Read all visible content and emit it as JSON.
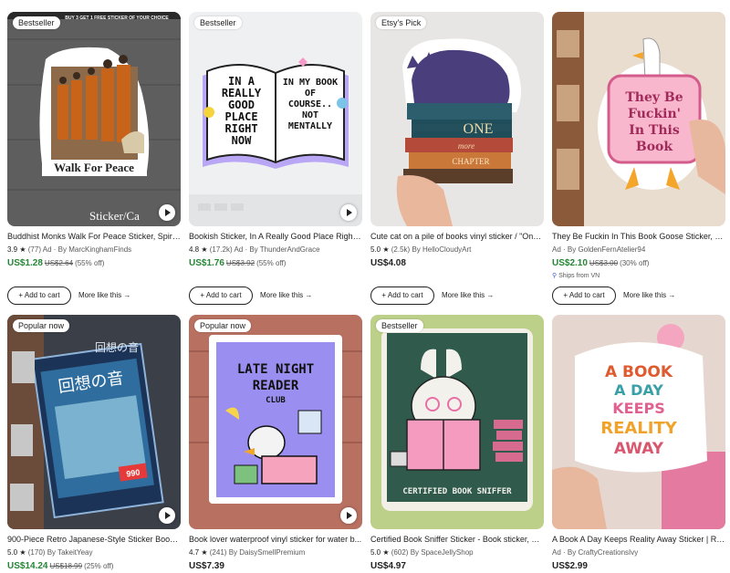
{
  "listings": [
    {
      "badge": "Bestseller",
      "title": "Buddhist Monks Walk For Peace Sticker, Spirit...",
      "rating": "3.9",
      "reviews": "(77)",
      "ad": "Ad · By MarcKinghamFinds",
      "price": "US$1.28",
      "orig": "US$2.64",
      "discount": "(55% off)",
      "image_text": "Walk For Peace",
      "image_text2": "Sticker/Ca",
      "image_text3": "BUY 3 GET 1 FREE STICKER OF YOUR CHOICE",
      "add": "+ Add to cart",
      "more": "More like this →"
    },
    {
      "badge": "Bestseller",
      "title": "Bookish Sticker, In A Really Good Place Right ...",
      "rating": "4.8",
      "reviews": "(17.2k)",
      "ad": "Ad · By ThunderAndGrace",
      "price": "US$1.76",
      "orig": "US$3.92",
      "discount": "(55% off)",
      "image_text": "IN A REALLY GOOD PLACE RIGHT NOW",
      "image_text2": "IN MY BOOK OF COURSE.. NOT MENTALLY",
      "add": "+ Add to cart",
      "more": "More like this →"
    },
    {
      "badge": "Etsy's Pick",
      "title": "Cute cat on a pile of books vinyl sticker / \"One...",
      "rating": "5.0",
      "reviews": "(2.5k)",
      "ad": "By HelloCloudyArt",
      "price": "US$4.08",
      "image_text": "ONE",
      "image_text2": "more",
      "image_text3": "CHAPTER",
      "add": "+ Add to cart",
      "more": "More like this →"
    },
    {
      "title": "They Be Fuckin In This Book Goose Sticker, Fu...",
      "ad": "Ad · By GoldenFernAtelier94",
      "price": "US$2.10",
      "orig": "US$3.00",
      "discount": "(30% off)",
      "ships": "Ships from VN",
      "image_text": "They Be",
      "image_text2": "Fuckin'",
      "image_text3": "In This",
      "image_text4": "Book",
      "add": "+ Add to cart",
      "more": "More like this →"
    },
    {
      "badge": "Popular now",
      "title": "900-Piece Retro Japanese-Style Sticker Book |...",
      "rating": "5.0",
      "reviews": "(170)",
      "ad": "By TakeitYeay",
      "price": "US$14.24",
      "orig": "US$18.99",
      "discount": "(25% off)",
      "image_text": "回想の音",
      "image_text2": "回想の音",
      "image_text3": "990"
    },
    {
      "badge": "Popular now",
      "title": "Book lover waterproof vinyl sticker for water b...",
      "rating": "4.7",
      "reviews": "(241)",
      "ad": "By DaisySmellPremium",
      "price": "US$7.39",
      "image_text": "LATE NIGHT",
      "image_text2": "READER",
      "image_text3": "CLUB"
    },
    {
      "badge": "Bestseller",
      "title": "Certified Book Sniffer Sticker - Book sticker, Vi...",
      "rating": "5.0",
      "reviews": "(602)",
      "ad": "By SpaceJellyShop",
      "price": "US$4.97",
      "image_text": "CERTIFIED BOOK SNIFFER"
    },
    {
      "title": "A Book A Day Keeps Reality Away Sticker | Retr...",
      "ad": "Ad · By CraftyCreationsIvy",
      "price": "US$2.99",
      "image_text": "A BOOK",
      "image_text2": "A DAY",
      "image_text3": "KEEPS",
      "image_text4": "REALITY",
      "image_text5": "AWAY"
    }
  ],
  "colors": {
    "sale_price": "#258635",
    "text": "#222222",
    "muted": "#595959"
  }
}
